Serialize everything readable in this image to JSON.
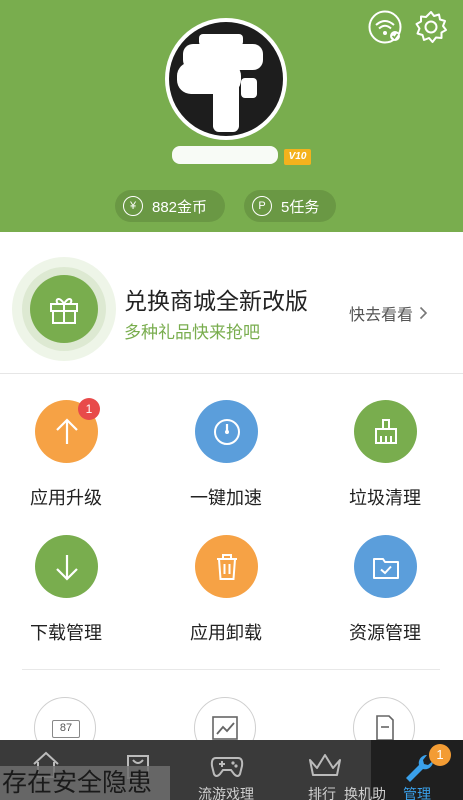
{
  "header": {
    "vip_label": "V10",
    "coins_label": "882金币",
    "coins_icon_glyph": "¥",
    "tasks_label": "5任务",
    "tasks_icon_glyph": "P",
    "bg_color": "#79ad4e"
  },
  "banner": {
    "title": "兑换商城全新改版",
    "subtitle": "多种礼品快来抢吧",
    "link_label": "快去看看"
  },
  "tools": [
    {
      "label": "应用升级",
      "icon": "arrow-up-icon",
      "color": "#f6a245",
      "badge": "1"
    },
    {
      "label": "一键加速",
      "icon": "speedometer-icon",
      "color": "#5b9edb"
    },
    {
      "label": "垃圾清理",
      "icon": "broom-icon",
      "color": "#79ad4e"
    },
    {
      "label": "下载管理",
      "icon": "arrow-down-icon",
      "color": "#79ad4e"
    },
    {
      "label": "应用卸载",
      "icon": "trash-icon",
      "color": "#f6a245"
    },
    {
      "label": "资源管理",
      "icon": "folder-check-icon",
      "color": "#5b9edb"
    }
  ],
  "bottom_tools": {
    "battery_value": "87"
  },
  "nav": {
    "items": [
      {
        "label": "",
        "icon": "home-icon"
      },
      {
        "label": "",
        "icon": "bag-icon"
      },
      {
        "label": "流游戏理",
        "icon": "gamepad-icon"
      },
      {
        "label": "排行",
        "icon": "crown-icon"
      },
      {
        "label": "管理",
        "icon": "wrench-icon",
        "badge": "1",
        "active": true
      }
    ],
    "under_text": "换机助"
  },
  "toast": {
    "text": "存在安全隐患"
  }
}
